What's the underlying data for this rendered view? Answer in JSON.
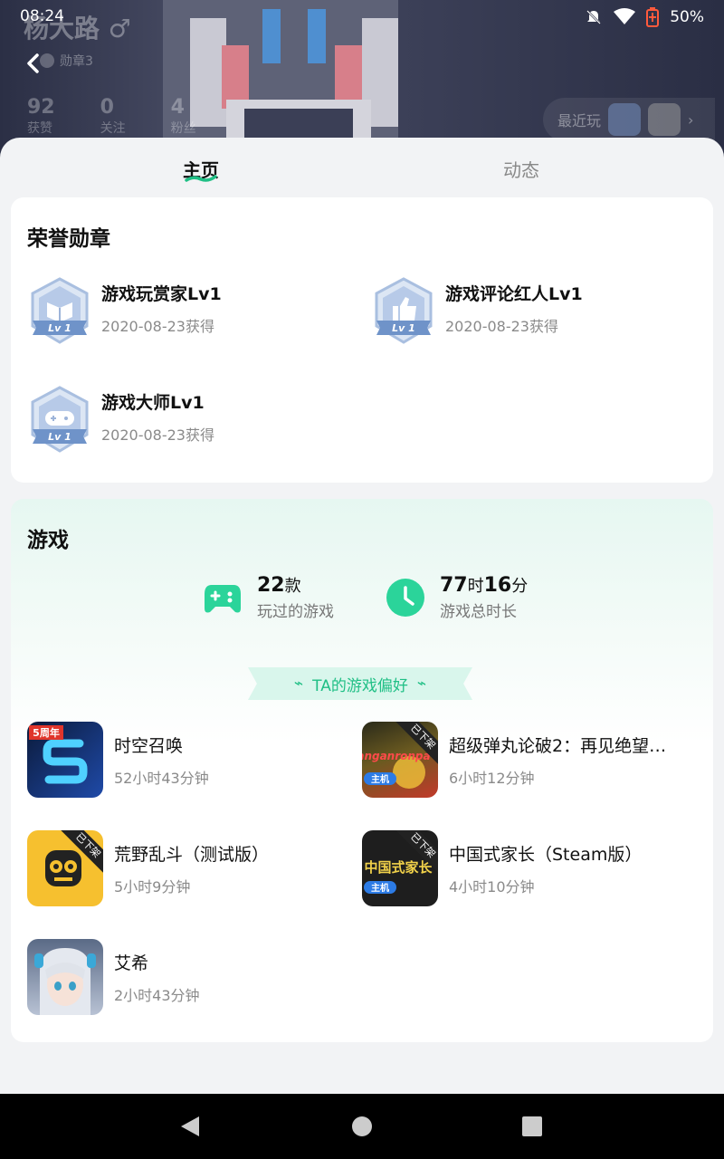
{
  "status_bar": {
    "time": "08:24",
    "battery": "50%"
  },
  "header": {
    "name": "杨大路",
    "gender_symbol": "♂",
    "badge_label": "勋章3",
    "stats": [
      {
        "value": "92",
        "label": "获赞"
      },
      {
        "value": "0",
        "label": "关注"
      },
      {
        "value": "4",
        "label": "粉丝"
      }
    ],
    "recent_label": "最近玩"
  },
  "tabs": [
    {
      "label": "主页",
      "active": true
    },
    {
      "label": "动态",
      "active": false
    }
  ],
  "honor": {
    "title": "荣誉勋章",
    "medals": [
      {
        "name": "游戏玩赏家Lv1",
        "date": "2020-08-23获得",
        "icon": "book-medal-icon",
        "level": "Lv 1"
      },
      {
        "name": "游戏评论红人Lv1",
        "date": "2020-08-23获得",
        "icon": "thumb-medal-icon",
        "level": "Lv 1"
      },
      {
        "name": "游戏大师Lv1",
        "date": "2020-08-23获得",
        "icon": "gamepad-medal-icon",
        "level": "Lv 1"
      }
    ]
  },
  "games": {
    "title": "游戏",
    "played_count": "22",
    "played_unit": "款",
    "played_label": "玩过的游戏",
    "hours": "77",
    "hours_unit": "时",
    "minutes": "16",
    "minutes_unit": "分",
    "time_label": "游戏总时长",
    "preference_label": "TA的游戏偏好",
    "list": [
      {
        "name": "时空召唤",
        "time": "52小时43分钟",
        "icon_badge": "5周年"
      },
      {
        "name": "超级弹丸论破2：再见绝望…",
        "time": "6小时12分钟",
        "tag": "已下架",
        "icon_badge": "主机"
      },
      {
        "name": "荒野乱斗（测试版）",
        "time": "5小时9分钟",
        "tag": "已下架"
      },
      {
        "name": "中国式家长（Steam版）",
        "time": "4小时10分钟",
        "tag": "已下架",
        "icon_badge": "主机",
        "icon_text": "中国式家长"
      },
      {
        "name": "艾希",
        "time": "2小时43分钟"
      }
    ]
  },
  "colors": {
    "accent": "#1fbf85",
    "medal_blue": "#6f93c9"
  }
}
